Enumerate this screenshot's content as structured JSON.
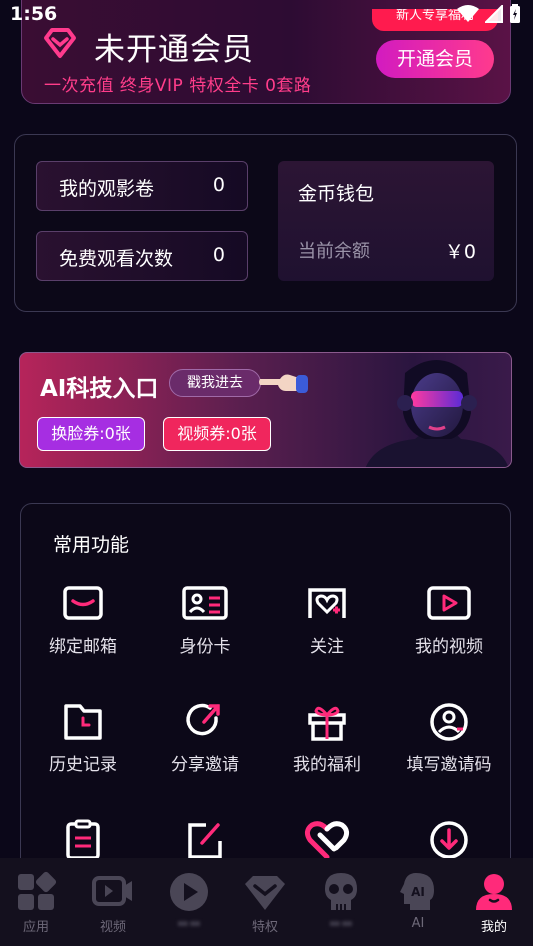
{
  "status_bar": {
    "time": "1:56"
  },
  "vip": {
    "title": "未开通会员",
    "subtitle": "一次充值 终身VIP 特权全卡 0套路",
    "ribbon": "新人专享福利",
    "button_label": "开通会员"
  },
  "wallet": {
    "tickets": [
      {
        "label": "我的观影卷",
        "value": "0"
      },
      {
        "label": "免费观看次数",
        "value": "0"
      }
    ],
    "coin": {
      "title": "金币钱包",
      "balance_label": "当前余额",
      "balance_value": "￥0"
    }
  },
  "ai_banner": {
    "title": "AI科技入口",
    "tag": "戳我进去",
    "face_coupon": "换脸券:0张",
    "video_coupon": "视频券:0张"
  },
  "functions": {
    "title": "常用功能",
    "items": [
      {
        "label": "绑定邮箱",
        "icon": "mail-icon"
      },
      {
        "label": "身份卡",
        "icon": "id-card-icon"
      },
      {
        "label": "关注",
        "icon": "follow-heart-icon"
      },
      {
        "label": "我的视频",
        "icon": "video-play-icon"
      },
      {
        "label": "历史记录",
        "icon": "history-folder-icon"
      },
      {
        "label": "分享邀请",
        "icon": "share-arrow-icon"
      },
      {
        "label": "我的福利",
        "icon": "gift-icon"
      },
      {
        "label": "填写邀请码",
        "icon": "invite-user-icon"
      },
      {
        "label": "",
        "icon": "clipboard-icon"
      },
      {
        "label": "",
        "icon": "edit-icon"
      },
      {
        "label": "",
        "icon": "heart-link-icon"
      },
      {
        "label": "",
        "icon": "download-icon"
      }
    ]
  },
  "nav": {
    "items": [
      {
        "label": "应用",
        "icon": "apps-icon"
      },
      {
        "label": "视频",
        "icon": "video-icon"
      },
      {
        "label": "",
        "icon": "play-icon"
      },
      {
        "label": "特权",
        "icon": "diamond-icon"
      },
      {
        "label": "",
        "icon": "skull-icon"
      },
      {
        "label": "AI",
        "icon": "ai-head-icon"
      },
      {
        "label": "我的",
        "icon": "profile-icon"
      }
    ],
    "active_label": "我的"
  },
  "colors": {
    "accent_pink": "#ff3a8d",
    "accent_magenta": "#d21bc0",
    "background": "#0b0719",
    "face_coupon": "#a62ee2",
    "video_coupon": "#f0265d"
  }
}
